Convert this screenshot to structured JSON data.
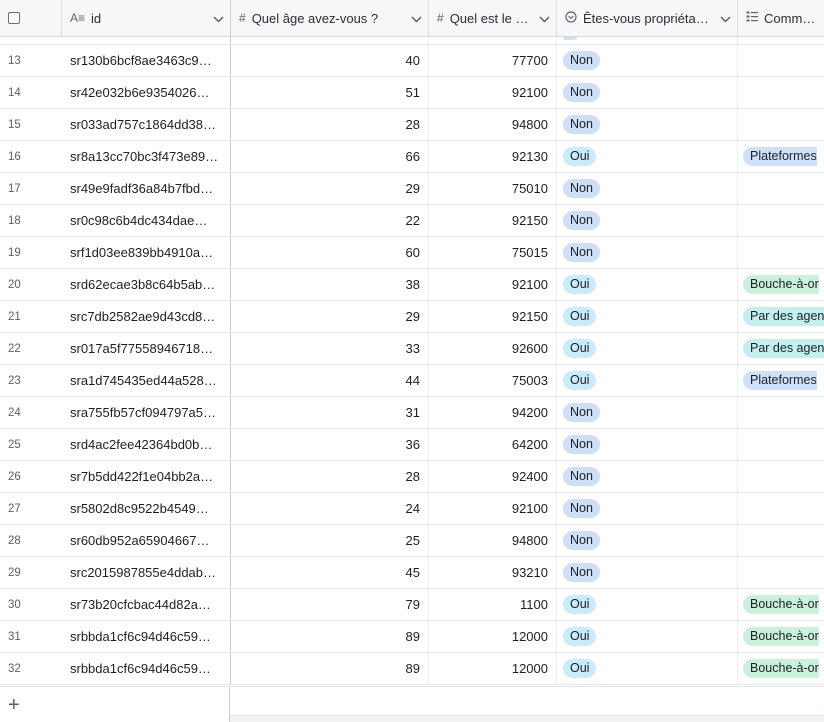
{
  "columns": {
    "id": "id",
    "age": "Quel âge avez-vous ?",
    "cp": "Quel est le …",
    "owner": "Êtes-vous propriéta…",
    "comment": "Comment"
  },
  "icons": {
    "id_type": "text-icon",
    "age_type": "number-icon",
    "cp_type": "number-icon",
    "owner_type": "single-select-icon",
    "comment_type": "multi-select-icon"
  },
  "rows": [
    {
      "n": "13",
      "id": "sr130b6bcf8ae3463c9…",
      "age": "40",
      "cp": "77700",
      "owner": "Non",
      "comment": ""
    },
    {
      "n": "14",
      "id": "sr42e032b6e9354026…",
      "age": "51",
      "cp": "92100",
      "owner": "Non",
      "comment": ""
    },
    {
      "n": "15",
      "id": "sr033ad757c1864dd38…",
      "age": "28",
      "cp": "94800",
      "owner": "Non",
      "comment": ""
    },
    {
      "n": "16",
      "id": "sr8a13cc70bc3f473e89…",
      "age": "66",
      "cp": "92130",
      "owner": "Oui",
      "comment": "Plateformes"
    },
    {
      "n": "17",
      "id": "sr49e9fadf36a84b7fbd…",
      "age": "29",
      "cp": "75010",
      "owner": "Non",
      "comment": ""
    },
    {
      "n": "18",
      "id": "sr0c98c6b4dc434dae…",
      "age": "22",
      "cp": "92150",
      "owner": "Non",
      "comment": ""
    },
    {
      "n": "19",
      "id": "srf1d03ee839bb4910a…",
      "age": "60",
      "cp": "75015",
      "owner": "Non",
      "comment": ""
    },
    {
      "n": "20",
      "id": "srd62ecae3b8c64b5ab…",
      "age": "38",
      "cp": "92100",
      "owner": "Oui",
      "comment": "Bouche-à-or"
    },
    {
      "n": "21",
      "id": "src7db2582ae9d43cd8…",
      "age": "29",
      "cp": "92150",
      "owner": "Oui",
      "comment": "Par des agen"
    },
    {
      "n": "22",
      "id": "sr017a5f77558946718…",
      "age": "33",
      "cp": "92600",
      "owner": "Oui",
      "comment": "Par des agen"
    },
    {
      "n": "23",
      "id": "sra1d745435ed44a528…",
      "age": "44",
      "cp": "75003",
      "owner": "Oui",
      "comment": "Plateformes"
    },
    {
      "n": "24",
      "id": "sra755fb57cf094797a5…",
      "age": "31",
      "cp": "94200",
      "owner": "Non",
      "comment": ""
    },
    {
      "n": "25",
      "id": "srd4ac2fee42364bd0b…",
      "age": "36",
      "cp": "64200",
      "owner": "Non",
      "comment": ""
    },
    {
      "n": "26",
      "id": "sr7b5dd422f1e04bb2a…",
      "age": "28",
      "cp": "92400",
      "owner": "Non",
      "comment": ""
    },
    {
      "n": "27",
      "id": "sr5802d8c9522b4549…",
      "age": "24",
      "cp": "92100",
      "owner": "Non",
      "comment": ""
    },
    {
      "n": "28",
      "id": "sr60db952a65904667…",
      "age": "25",
      "cp": "94800",
      "owner": "Non",
      "comment": ""
    },
    {
      "n": "29",
      "id": "src2015987855e4ddab…",
      "age": "45",
      "cp": "93210",
      "owner": "Non",
      "comment": ""
    },
    {
      "n": "30",
      "id": "sr73b20cfcbac44d82a…",
      "age": "79",
      "cp": "1100",
      "owner": "Oui",
      "comment": "Bouche-à-or"
    },
    {
      "n": "31",
      "id": "srbbda1cf6c94d46c59…",
      "age": "89",
      "cp": "12000",
      "owner": "Oui",
      "comment": "Bouche-à-or"
    },
    {
      "n": "32",
      "id": "srbbda1cf6c94d46c59…",
      "age": "89",
      "cp": "12000",
      "owner": "Oui",
      "comment": "Bouche-à-or"
    }
  ],
  "colors": {
    "non_pill": "#cfdff5",
    "oui_pill": "#c8ecfb",
    "bouche_pill": "#c8f2d9",
    "agen_pill": "#c2f0ee",
    "plateformes_pill": "#cfe0fb"
  },
  "footer": {
    "add_row": "+"
  }
}
